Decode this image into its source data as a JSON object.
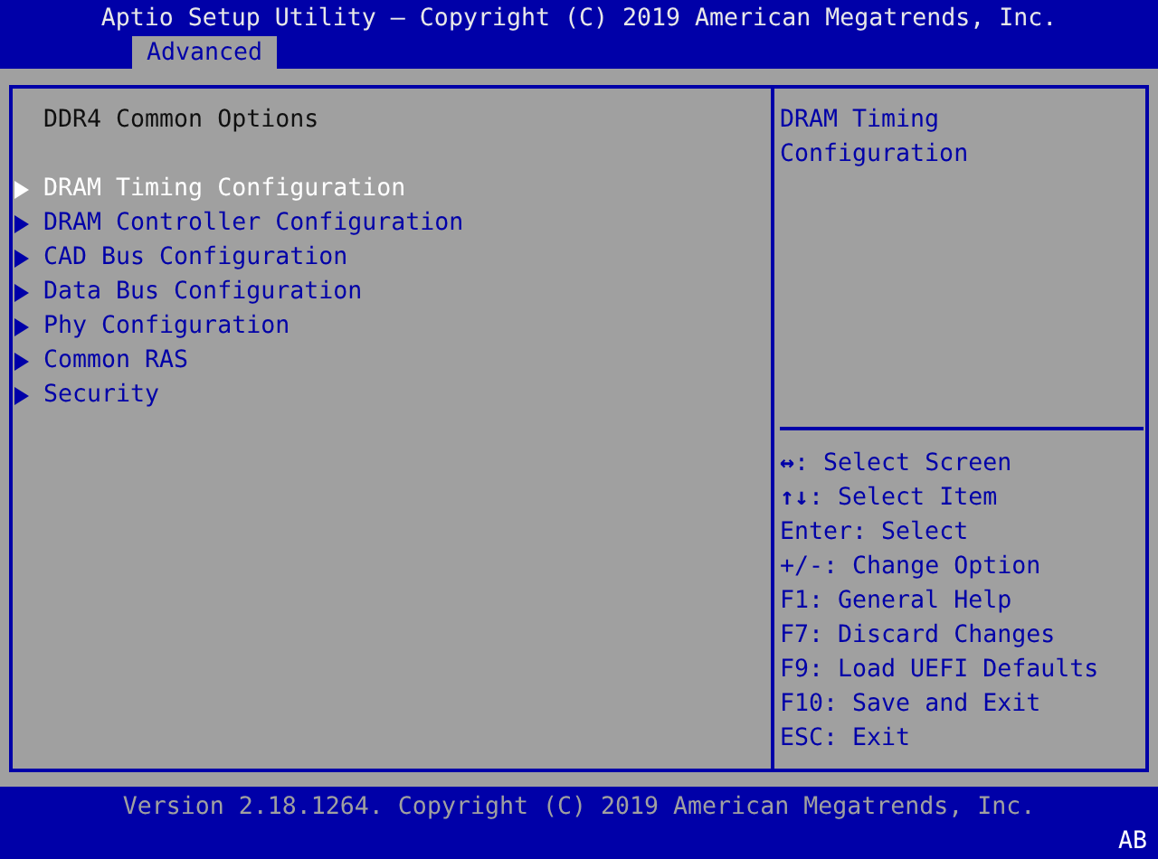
{
  "title": "Aptio Setup Utility – Copyright (C) 2019 American Megatrends, Inc.",
  "tabs": [
    {
      "label": "Advanced",
      "selected": true
    }
  ],
  "heading": "DDR4 Common Options",
  "items": [
    {
      "label": "DRAM Timing Configuration",
      "selected": true
    },
    {
      "label": "DRAM Controller Configuration",
      "selected": false
    },
    {
      "label": "CAD Bus Configuration",
      "selected": false
    },
    {
      "label": "Data Bus Configuration",
      "selected": false
    },
    {
      "label": "Phy Configuration",
      "selected": false
    },
    {
      "label": "Common RAS",
      "selected": false
    },
    {
      "label": "Security",
      "selected": false
    }
  ],
  "help": [
    "DRAM Timing",
    "Configuration"
  ],
  "keys": [
    {
      "key": "↔",
      "action": ": Select Screen"
    },
    {
      "key": "↑↓",
      "action": ": Select Item"
    },
    {
      "key": "Enter",
      "action": ": Select"
    },
    {
      "key": "+/-",
      "action": ": Change Option"
    },
    {
      "key": "F1",
      "action": ": General Help"
    },
    {
      "key": "F7",
      "action": ": Discard Changes"
    },
    {
      "key": "F9",
      "action": ": Load UEFI Defaults"
    },
    {
      "key": "F10",
      "action": ": Save and Exit"
    },
    {
      "key": "ESC",
      "action": ": Exit"
    }
  ],
  "footer": "Version 2.18.1264. Copyright (C) 2019 American Megatrends, Inc.",
  "corner": "AB"
}
